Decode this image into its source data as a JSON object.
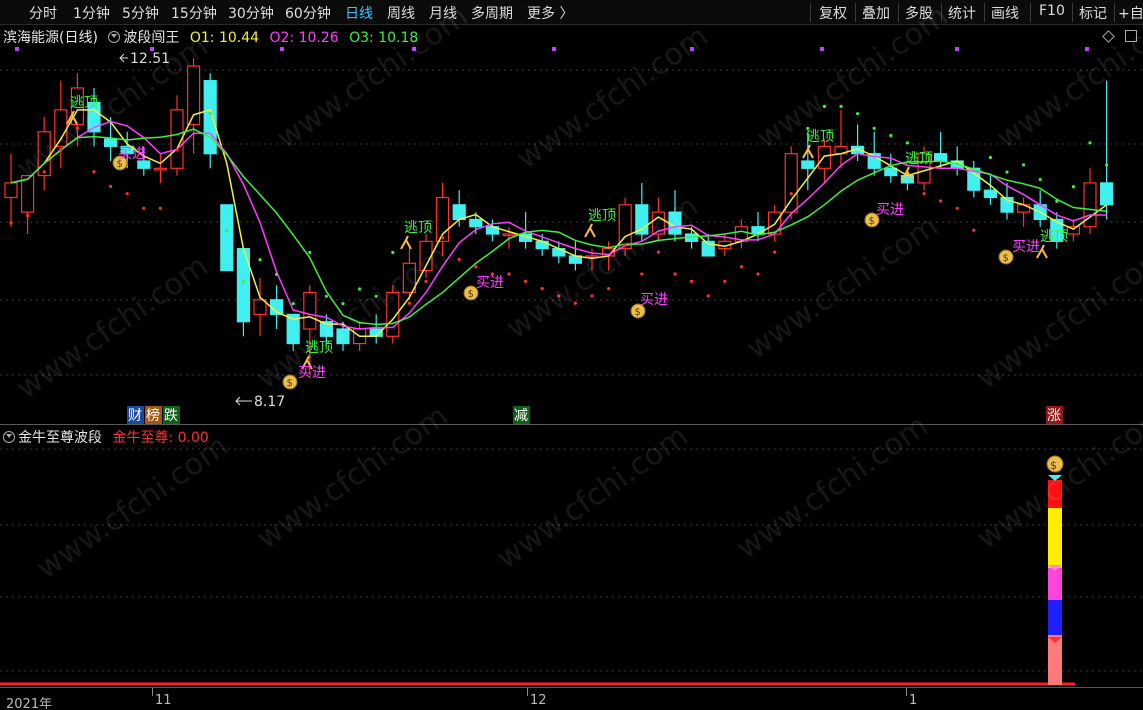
{
  "toolbar": {
    "periods": [
      "分时",
      "1分钟",
      "5分钟",
      "15分钟",
      "30分钟",
      "60分钟",
      "日线",
      "周线",
      "月线",
      "多周期",
      "更多 〉"
    ],
    "active_period": "日线",
    "tools": [
      "复权",
      "叠加",
      "多股",
      "统计",
      "画线",
      "F10",
      "标记",
      "+自"
    ]
  },
  "main_legend": {
    "stock": "滨海能源(日线)",
    "indicator": "波段闯王",
    "o1_label": "O1: ",
    "o1_value": "10.44",
    "o2_label": "O2: ",
    "o2_value": "10.26",
    "o3_label": "O3: ",
    "o3_value": "10.18"
  },
  "annotations": {
    "high_price": "12.51",
    "low_price": "8.17",
    "escape_top": "逃顶",
    "buy_in": "买进",
    "event_cai": "财",
    "event_bang": "榜",
    "event_die": "跌",
    "event_jian": "减",
    "event_zhang": "涨"
  },
  "sub_legend": {
    "indicator": "金牛至尊波段",
    "value_label": "金牛至尊: ",
    "value": "0.00"
  },
  "x_axis": {
    "labels": [
      "2021年",
      "11",
      "12",
      "1"
    ]
  },
  "watermark": "www.cfchi.com",
  "colors": {
    "up": "#ff3030",
    "down": "#40f0f0",
    "ma1": "#f2f23a",
    "ma2": "#ff3cff",
    "ma3": "#3cf03c",
    "active": "#38c7ff"
  },
  "chart_data": {
    "type": "candlestick",
    "price_marks": [
      12.51,
      8.17
    ],
    "indicator_values": {
      "O1": 10.44,
      "O2": 10.26,
      "O3": 10.18
    }
  }
}
